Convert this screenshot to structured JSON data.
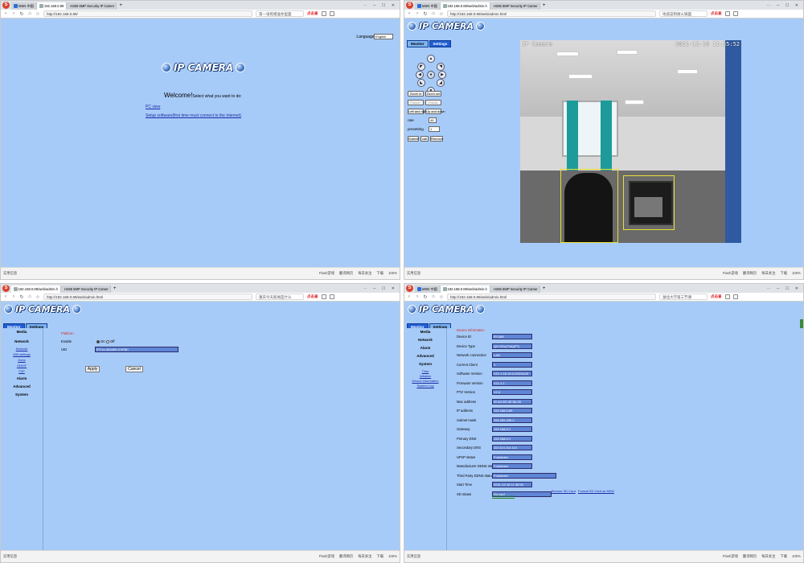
{
  "browser": {
    "logo": "S",
    "new_tab": "+",
    "window_controls": "⋯ ─ ☐ ✕",
    "hot_label": "点击查",
    "status_left": "实用信息",
    "status_items": [
      "Flash游戏",
      "翻译网页",
      "每日关注"
    ],
    "status_right": [
      "下载",
      "100%"
    ]
  },
  "q1": {
    "tabs": [
      "MSN 中国",
      "192.168.0.89",
      "H265 5MP Security IP Camer"
    ],
    "address": "http://192.168.0.89/",
    "search": "第一张照相准你里面",
    "language_label": "Language:",
    "language_value": "English",
    "brand": "IP CAMERA",
    "welcome": "Welcome!",
    "welcome_sub": "Select what you want to do:",
    "link_pc": "PC view",
    "link_setup": "Setup software(first time must connect to the Internet)"
  },
  "q2": {
    "tabs": [
      "MSN 中国",
      "192.168.0.89/web/admin.h",
      "H265 5MP Security IP Camer"
    ],
    "address": "http://192.168.0.89/web/admin.html",
    "search": "地道菜和厨火锅面",
    "brand": "IP CAMERA",
    "tab_monitor": "Monitor",
    "tab_settings": "Settings",
    "zoom_in": "Zoom in",
    "zoom_out": "Zoom out",
    "focus_in": "Focus+",
    "focus_out": "Focus-",
    "left_right": "Left and right",
    "up_down": "Up and down",
    "rate_label": "rate",
    "rate_value": "45",
    "preset_label": "presetting",
    "preset_value": "1",
    "submit": "Submit",
    "call": "call",
    "remove": "Remove",
    "overlay_name": "IP Camera",
    "overlay_time": "2021-12-18 11:35:52"
  },
  "q3": {
    "tabs": [
      "192.168.0.89/web/admin.h",
      "H265 5MP Security IP Camer"
    ],
    "address": "http://192.168.0.89/web/admin.html",
    "search": "重庆今天新闻是什么",
    "brand": "IP CAMERA",
    "tab_monitor": "Monitor",
    "tab_settings": "Settings",
    "side_media": "Media",
    "side_network": "Network",
    "side_links": [
      "Network",
      "Wifi settings",
      "Ddns",
      "ONVIF",
      "P2P"
    ],
    "side_alarm": "Alarm",
    "side_advanced": "Advanced",
    "side_system": "System",
    "section": "Platform",
    "enable_label": "Enable",
    "radio_on": "On",
    "radio_off": "Off",
    "uid_label": "UID",
    "uid_value": "IPCxx-364469-XXFBC",
    "apply": "Apply",
    "cancel": "Cancel"
  },
  "q4": {
    "tabs": [
      "MSN 中国",
      "192.168.0.89/web/admin.h",
      "H265 5MP Security IP Camer"
    ],
    "address": "http://192.168.0.89/web/admin.html",
    "search": "湖北大学第三节课",
    "brand": "IP CAMERA",
    "tab_monitor": "Monitor",
    "tab_settings": "Settings",
    "side_media": "Media",
    "side_network": "Network",
    "side_alarm": "Alarm",
    "side_advanced": "Advanced",
    "side_system": "System",
    "side_links": [
      "Time",
      "Initialize",
      "Device information",
      "System Log"
    ],
    "section": "Device information",
    "rows": [
      {
        "label": "Device ID",
        "value": "IPCAM"
      },
      {
        "label": "Device Type",
        "value": "QH-SSx(7VA)(PT)"
      },
      {
        "label": "Network connection",
        "value": "LAN"
      },
      {
        "label": "Current Client",
        "value": "1"
      },
      {
        "label": "Software Version",
        "value": "V21.1.16.16.3-20211115"
      },
      {
        "label": "Firmware Version",
        "value": "V21.1.1"
      },
      {
        "label": "PTZ Version",
        "value": "V2.0"
      },
      {
        "label": "Mac address",
        "value": "00:A2:E0:4E:5A:05"
      },
      {
        "label": "IP address",
        "value": "192.168.0.89"
      },
      {
        "label": "Subnet mask",
        "value": "255.255.255.0"
      },
      {
        "label": "Gateway",
        "value": "192.168.0.1"
      },
      {
        "label": "Primary DNS",
        "value": "192.168.0.1"
      },
      {
        "label": "Secondary DNS",
        "value": "114.114.114.114"
      },
      {
        "label": "UPnP status",
        "value": "Forbidden"
      },
      {
        "label": "Manufacturer DDNS status",
        "value": "Forbidden"
      },
      {
        "label": "Third Party DDNS status",
        "value": "Forbidden"
      },
      {
        "label": "Start Time",
        "value": "2021-12-18 11:36:55"
      },
      {
        "label": "SD status",
        "value": "No card"
      }
    ],
    "browse_sd": "Browse SD Card",
    "format_sd": "Format SD Card as NEW",
    "refresh": "refresh SD card"
  }
}
